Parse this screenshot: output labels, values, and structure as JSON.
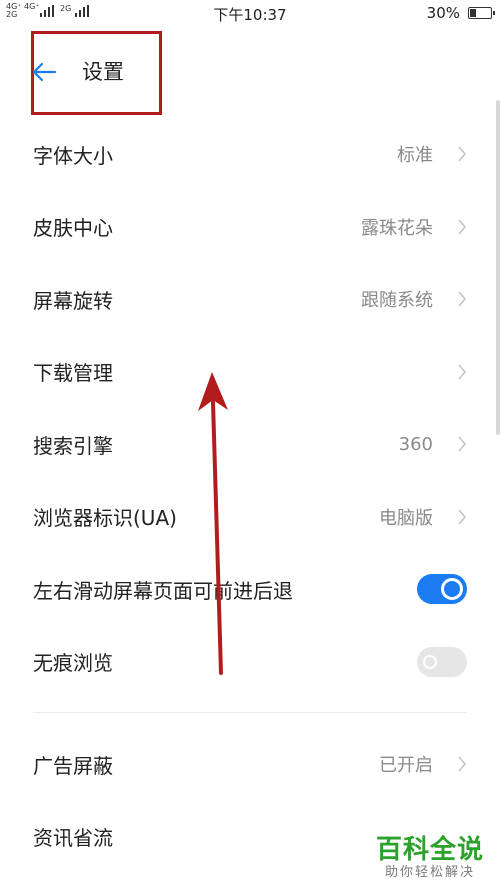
{
  "status_bar": {
    "network_top": "4G⁺ 4G⁺",
    "network_bottom": "2G",
    "network_extra": "2G",
    "time": "下午10:37",
    "battery_pct": "30%"
  },
  "header": {
    "back_icon": "arrow-left-icon",
    "title": "设置"
  },
  "colors": {
    "accent": "#1a7cf0",
    "annotation": "#b11d1d",
    "watermark": "#2ca12c"
  },
  "settings": {
    "items": [
      {
        "label": "字体大小",
        "value": "标准"
      },
      {
        "label": "皮肤中心",
        "value": "露珠花朵"
      },
      {
        "label": "屏幕旋转",
        "value": "跟随系统"
      },
      {
        "label": "下载管理",
        "value": ""
      },
      {
        "label": "搜索引擎",
        "value": "360"
      },
      {
        "label": "浏览器标识(UA)",
        "value": "电脑版"
      },
      {
        "label": "左右滑动屏幕页面可前进后退",
        "toggle": "on"
      },
      {
        "label": "无痕浏览",
        "toggle": "off"
      },
      {
        "label": "广告屏蔽",
        "value": "已开启"
      },
      {
        "label": "资讯省流",
        "value": ""
      }
    ]
  },
  "watermark": {
    "main": "百科全说",
    "sub": "助你轻松解决"
  }
}
